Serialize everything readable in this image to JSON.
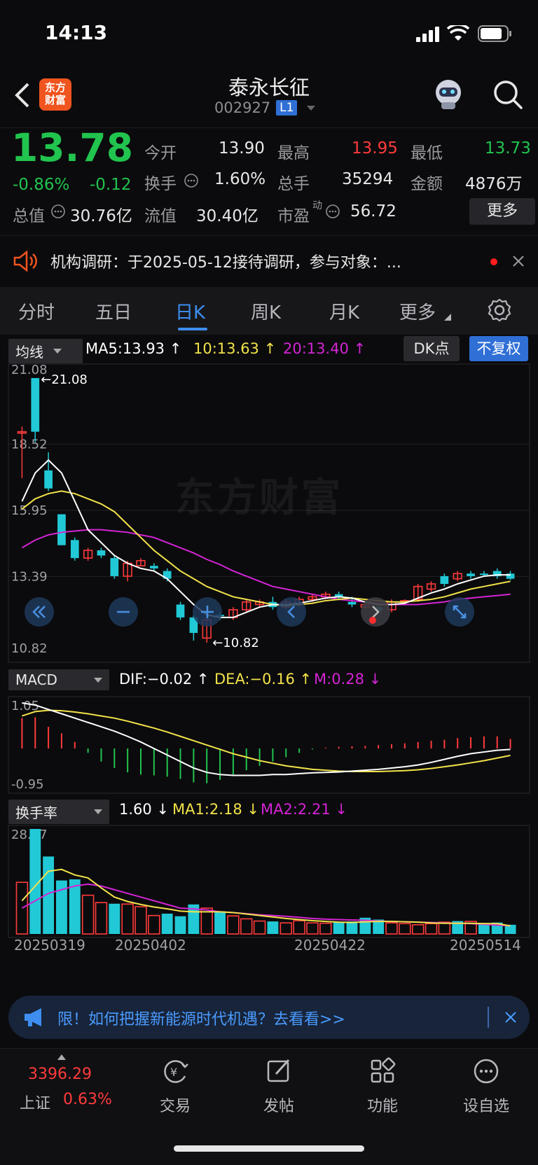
{
  "status_bar": {
    "time": "14:13"
  },
  "header": {
    "logo_text_1": "东方",
    "logo_text_2": "财富",
    "stock_name": "泰永长征",
    "stock_code": "002927",
    "level_badge": "L1"
  },
  "quote": {
    "price": "13.78",
    "change_pct": "-0.86%",
    "change": "-0.12",
    "fields": {
      "open_label": "今开",
      "open": "13.90",
      "high_label": "最高",
      "high": "13.95",
      "low_label": "最低",
      "low": "13.73",
      "turnover_label": "换手",
      "turnover": "1.60%",
      "volume_label": "总手",
      "volume": "35294",
      "amount_label": "金额",
      "amount": "4876万",
      "mktcap_label": "总值",
      "mktcap": "30.76亿",
      "float_label": "流值",
      "float": "30.40亿",
      "pe_label": "市盈",
      "pe_sup": "动",
      "pe": "56.72"
    },
    "more_button": "更多"
  },
  "notice": {
    "text": "机构调研：于2025-05-12接待调研，参与对象：..."
  },
  "tabs": [
    {
      "label": "分时"
    },
    {
      "label": "五日"
    },
    {
      "label": "日K"
    },
    {
      "label": "周K"
    },
    {
      "label": "月K"
    },
    {
      "label": "更多"
    }
  ],
  "active_tab": "日K",
  "kline": {
    "indicator_select": "均线",
    "ma5": "MA5:13.93",
    "ma10": "10:13.63",
    "ma20": "20:13.40",
    "dk_button": "DK点",
    "adjust_button": "不复权",
    "axis_labels": [
      "21.08",
      "18.52",
      "15.95",
      "13.39",
      "10.82"
    ],
    "max_marker": "21.08",
    "min_marker": "10.82",
    "watermark": "东方财富"
  },
  "macd": {
    "indicator_select": "MACD",
    "dif": "DIF:−0.02",
    "dea": "DEA:−0.16",
    "m": "M:0.28",
    "axis_top": "1.05",
    "axis_bottom": "-0.95"
  },
  "turnover_panel": {
    "indicator_select": "换手率",
    "value": "1.60",
    "ma1": "MA1:2.18",
    "ma2": "MA2:2.21",
    "axis_top": "28.47"
  },
  "dates": [
    "20250319",
    "20250402",
    "20250422",
    "20250514"
  ],
  "promo": {
    "text": "限！如何把握新能源时代机遇？去看看>>"
  },
  "bottom_nav": {
    "index_value": "3396.29",
    "index_name": "上证",
    "index_change": "0.63%",
    "items": [
      {
        "label": "交易"
      },
      {
        "label": "发帖"
      },
      {
        "label": "功能"
      },
      {
        "label": "设自选"
      }
    ]
  },
  "colors": {
    "up": "#ff3b3b",
    "down": "#21c9d6",
    "ma5": "#ffffff",
    "ma10": "#f2e24a",
    "ma20": "#d424d4",
    "accent": "#3d8ef0"
  },
  "chart_data": {
    "type": "candlestick",
    "candles": [
      {
        "o": 19.0,
        "c": 19.0,
        "h": 19.2,
        "l": 17.2,
        "dir": "up"
      },
      {
        "o": 19.0,
        "c": 21.08,
        "h": 21.08,
        "l": 18.6,
        "dir": "down"
      },
      {
        "o": 16.8,
        "c": 17.5,
        "h": 18.2,
        "l": 16.7,
        "dir": "down"
      },
      {
        "o": 15.8,
        "c": 14.6,
        "h": 15.8,
        "l": 14.6,
        "dir": "down"
      },
      {
        "o": 14.8,
        "c": 14.1,
        "h": 14.9,
        "l": 14.0,
        "dir": "down"
      },
      {
        "o": 14.1,
        "c": 14.4,
        "h": 14.5,
        "l": 14.0,
        "dir": "up"
      },
      {
        "o": 14.4,
        "c": 14.2,
        "h": 14.5,
        "l": 14.1,
        "dir": "down"
      },
      {
        "o": 14.1,
        "c": 13.4,
        "h": 14.2,
        "l": 13.3,
        "dir": "down"
      },
      {
        "o": 13.4,
        "c": 13.9,
        "h": 14.0,
        "l": 13.2,
        "dir": "up"
      },
      {
        "o": 13.8,
        "c": 14.0,
        "h": 14.1,
        "l": 13.8,
        "dir": "up"
      },
      {
        "o": 13.7,
        "c": 13.8,
        "h": 13.9,
        "l": 13.6,
        "dir": "down"
      },
      {
        "o": 13.6,
        "c": 13.3,
        "h": 13.7,
        "l": 13.2,
        "dir": "down"
      },
      {
        "o": 12.3,
        "c": 11.8,
        "h": 12.4,
        "l": 11.7,
        "dir": "down"
      },
      {
        "o": 11.8,
        "c": 11.2,
        "h": 11.9,
        "l": 10.9,
        "dir": "down"
      },
      {
        "o": 11.0,
        "c": 11.7,
        "h": 11.8,
        "l": 10.82,
        "dir": "up"
      },
      {
        "o": 11.9,
        "c": 11.85,
        "h": 12.0,
        "l": 11.7,
        "dir": "down"
      },
      {
        "o": 11.8,
        "c": 12.1,
        "h": 12.2,
        "l": 11.7,
        "dir": "up"
      },
      {
        "o": 12.1,
        "c": 12.4,
        "h": 12.5,
        "l": 12.0,
        "dir": "up"
      },
      {
        "o": 12.3,
        "c": 12.4,
        "h": 12.5,
        "l": 12.2,
        "dir": "up"
      },
      {
        "o": 12.4,
        "c": 12.2,
        "h": 12.6,
        "l": 12.1,
        "dir": "down"
      },
      {
        "o": 12.2,
        "c": 12.4,
        "h": 12.5,
        "l": 12.1,
        "dir": "up"
      },
      {
        "o": 12.3,
        "c": 12.5,
        "h": 12.6,
        "l": 12.2,
        "dir": "up"
      },
      {
        "o": 12.5,
        "c": 12.6,
        "h": 12.7,
        "l": 12.4,
        "dir": "up"
      },
      {
        "o": 12.6,
        "c": 12.7,
        "h": 12.8,
        "l": 12.5,
        "dir": "up"
      },
      {
        "o": 12.7,
        "c": 12.6,
        "h": 12.8,
        "l": 12.5,
        "dir": "down"
      },
      {
        "o": 12.4,
        "c": 12.3,
        "h": 12.6,
        "l": 12.2,
        "dir": "down"
      },
      {
        "o": 12.2,
        "c": 12.3,
        "h": 12.4,
        "l": 12.1,
        "dir": "up"
      },
      {
        "o": 12.2,
        "c": 12.05,
        "h": 12.3,
        "l": 11.95,
        "dir": "down"
      },
      {
        "o": 12.1,
        "c": 12.4,
        "h": 12.5,
        "l": 12.0,
        "dir": "up"
      },
      {
        "o": 12.4,
        "c": 12.45,
        "h": 12.5,
        "l": 12.3,
        "dir": "up"
      },
      {
        "o": 12.5,
        "c": 13.0,
        "h": 13.1,
        "l": 12.4,
        "dir": "up"
      },
      {
        "o": 12.9,
        "c": 13.1,
        "h": 13.2,
        "l": 12.8,
        "dir": "up"
      },
      {
        "o": 13.1,
        "c": 13.4,
        "h": 13.5,
        "l": 13.0,
        "dir": "down"
      },
      {
        "o": 13.3,
        "c": 13.5,
        "h": 13.6,
        "l": 13.2,
        "dir": "up"
      },
      {
        "o": 13.5,
        "c": 13.4,
        "h": 13.6,
        "l": 13.3,
        "dir": "down"
      },
      {
        "o": 13.45,
        "c": 13.5,
        "h": 13.6,
        "l": 13.4,
        "dir": "down"
      },
      {
        "o": 13.4,
        "c": 13.6,
        "h": 13.7,
        "l": 13.3,
        "dir": "down"
      },
      {
        "o": 13.5,
        "c": 13.3,
        "h": 13.6,
        "l": 13.25,
        "dir": "down"
      }
    ],
    "ma5": [
      16.3,
      17.4,
      17.9,
      17.4,
      16.3,
      15.2,
      14.7,
      14.2,
      13.9,
      13.7,
      13.6,
      13.3,
      12.8,
      12.3,
      11.9,
      11.8,
      11.8,
      12.0,
      12.2,
      12.3,
      12.3,
      12.35,
      12.45,
      12.55,
      12.6,
      12.55,
      12.4,
      12.3,
      12.3,
      12.35,
      12.55,
      12.75,
      12.9,
      13.1,
      13.25,
      13.4,
      13.45,
      13.45
    ],
    "ma10": [
      16.0,
      16.4,
      16.6,
      16.7,
      16.6,
      16.4,
      16.2,
      15.9,
      15.4,
      14.9,
      14.4,
      14.0,
      13.6,
      13.3,
      13.0,
      12.8,
      12.6,
      12.5,
      12.4,
      12.3,
      12.25,
      12.3,
      12.35,
      12.45,
      12.5,
      12.55,
      12.5,
      12.45,
      12.4,
      12.4,
      12.45,
      12.5,
      12.6,
      12.75,
      12.9,
      13.0,
      13.1,
      13.2
    ],
    "ma20": [
      14.5,
      14.8,
      15.0,
      15.1,
      15.15,
      15.2,
      15.2,
      15.15,
      15.1,
      15.0,
      14.9,
      14.7,
      14.5,
      14.3,
      14.05,
      13.85,
      13.6,
      13.4,
      13.2,
      13.0,
      12.9,
      12.8,
      12.7,
      12.6,
      12.5,
      12.45,
      12.4,
      12.35,
      12.3,
      12.3,
      12.3,
      12.35,
      12.4,
      12.5,
      12.55,
      12.6,
      12.65,
      12.7
    ],
    "macd_hist": [
      0.7,
      0.72,
      0.5,
      0.35,
      0.15,
      -0.1,
      -0.3,
      -0.45,
      -0.55,
      -0.6,
      -0.62,
      -0.65,
      -0.7,
      -0.78,
      -0.8,
      -0.72,
      -0.6,
      -0.5,
      -0.4,
      -0.3,
      -0.2,
      -0.1,
      -0.02,
      0.02,
      0.04,
      0.05,
      0.06,
      0.08,
      0.1,
      0.12,
      0.15,
      0.18,
      0.2,
      0.24,
      0.26,
      0.28,
      0.28,
      0.22
    ],
    "macd_dif": [
      1.05,
      1.0,
      0.9,
      0.8,
      0.7,
      0.6,
      0.5,
      0.4,
      0.28,
      0.15,
      0.0,
      -0.15,
      -0.3,
      -0.45,
      -0.55,
      -0.6,
      -0.62,
      -0.62,
      -0.62,
      -0.6,
      -0.6,
      -0.58,
      -0.56,
      -0.55,
      -0.54,
      -0.52,
      -0.5,
      -0.48,
      -0.45,
      -0.42,
      -0.38,
      -0.32,
      -0.25,
      -0.18,
      -0.12,
      -0.08,
      -0.04,
      -0.02
    ],
    "macd_dea": [
      0.75,
      0.85,
      0.88,
      0.87,
      0.84,
      0.8,
      0.75,
      0.7,
      0.63,
      0.55,
      0.47,
      0.38,
      0.28,
      0.18,
      0.08,
      -0.02,
      -0.12,
      -0.2,
      -0.28,
      -0.34,
      -0.4,
      -0.44,
      -0.48,
      -0.5,
      -0.52,
      -0.53,
      -0.53,
      -0.53,
      -0.52,
      -0.51,
      -0.49,
      -0.46,
      -0.42,
      -0.38,
      -0.33,
      -0.28,
      -0.22,
      -0.16
    ],
    "turnover": [
      14.0,
      28.47,
      21.0,
      14.5,
      14.8,
      10.5,
      8.5,
      8.2,
      8.1,
      7.4,
      5.0,
      5.5,
      4.8,
      8.0,
      7.0,
      6.1,
      4.9,
      4.1,
      3.5,
      3.4,
      3.0,
      3.6,
      3.0,
      2.9,
      3.2,
      3.4,
      4.4,
      3.9,
      3.0,
      2.8,
      2.5,
      2.8,
      3.2,
      3.5,
      3.4,
      3.0,
      3.1,
      2.5
    ],
    "turnover_dir": [
      "up",
      "down",
      "down",
      "down",
      "down",
      "up",
      "up",
      "down",
      "up",
      "up",
      "up",
      "down",
      "down",
      "down",
      "up",
      "down",
      "up",
      "up",
      "up",
      "down",
      "up",
      "up",
      "up",
      "up",
      "down",
      "down",
      "down",
      "down",
      "up",
      "up",
      "up",
      "up",
      "up",
      "down",
      "up",
      "down",
      "down",
      "down"
    ],
    "turnover_ma1": [
      9.0,
      13.0,
      17.0,
      17.5,
      16.0,
      15.2,
      12.5,
      10.0,
      8.8,
      8.0,
      7.3,
      6.8,
      6.2,
      6.0,
      6.0,
      6.0,
      5.8,
      5.4,
      5.0,
      4.6,
      4.2,
      3.9,
      3.6,
      3.4,
      3.2,
      3.1,
      3.3,
      3.4,
      3.4,
      3.3,
      3.2,
      3.0,
      2.9,
      2.9,
      2.9,
      2.8,
      2.8,
      2.18
    ],
    "turnover_ma2": [
      7.0,
      9.0,
      11.0,
      12.0,
      13.0,
      13.5,
      13.0,
      12.0,
      11.0,
      10.0,
      9.0,
      8.0,
      7.0,
      6.8,
      6.5,
      6.0,
      5.8,
      5.5,
      5.2,
      5.0,
      4.8,
      4.5,
      4.2,
      4.0,
      3.9,
      3.8,
      3.7,
      3.5,
      3.4,
      3.3,
      3.2,
      3.1,
      3.0,
      2.9,
      2.8,
      2.6,
      2.4,
      2.21
    ]
  }
}
